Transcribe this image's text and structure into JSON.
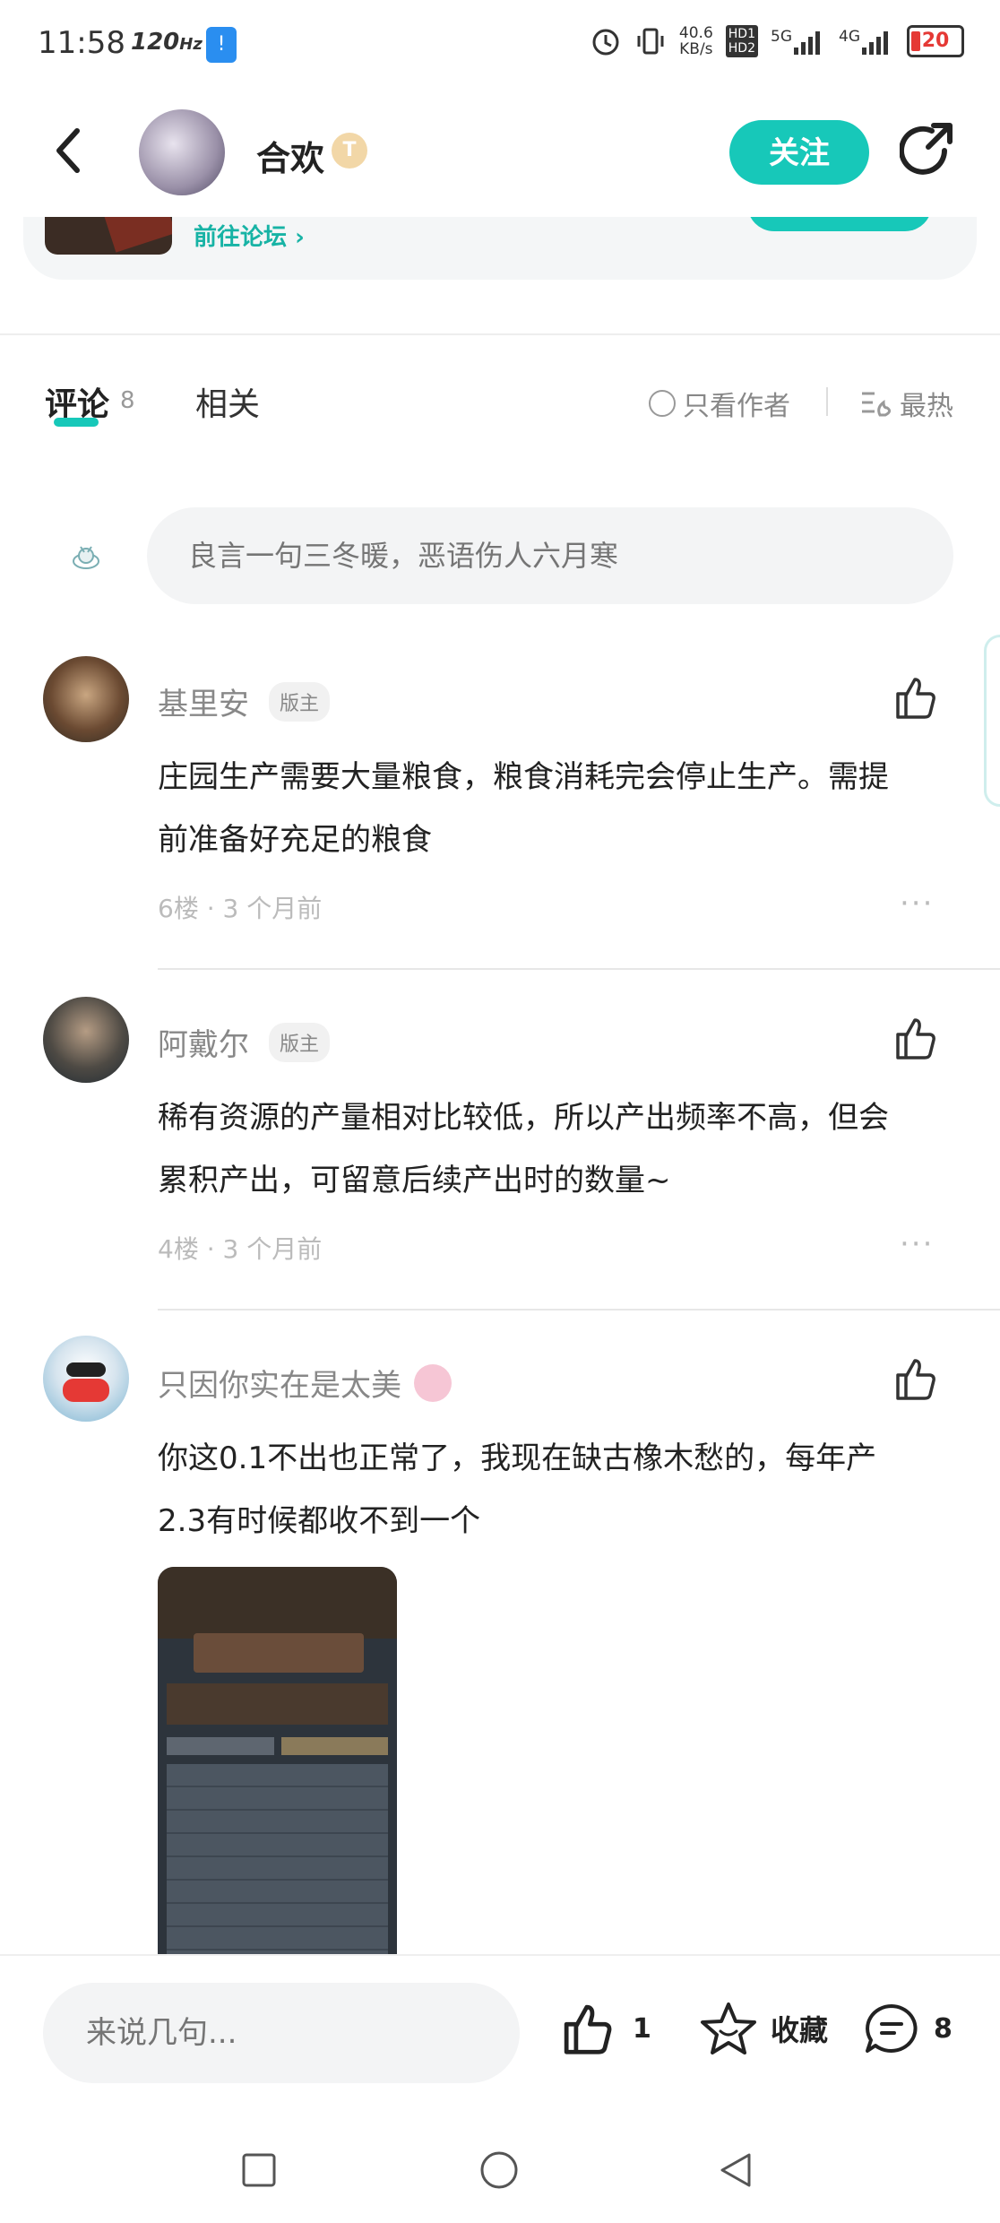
{
  "status_bar": {
    "time": "11:58",
    "refresh": "120",
    "refresh_unit": "Hz",
    "net_speed_top": "40.6",
    "net_speed_bottom": "KB/s",
    "hd1": "HD1",
    "hd2": "HD2",
    "sig5g": "5G",
    "sig4g": "4G",
    "battery": "20"
  },
  "header": {
    "author_name": "合欢",
    "level_badge": "T",
    "follow_label": "关注"
  },
  "forum_card": {
    "link_label": "前往论坛"
  },
  "tabs": {
    "comments_label": "评论",
    "comments_count": "8",
    "related_label": "相关",
    "only_author_label": "只看作者",
    "sort_label": "最热"
  },
  "comment_box": {
    "placeholder": "良言一句三冬暖，恶语伤人六月寒"
  },
  "comments": [
    {
      "name": "基里安",
      "badge": "版主",
      "line1": "庄园生产需要大量粮食，粮食消耗完会停止生产。需提",
      "line2": "前准备好充足的粮食",
      "meta": "6楼 · 3 个月前"
    },
    {
      "name": "阿戴尔",
      "badge": "版主",
      "line1": "稀有资源的产量相对比较低，所以产出频率不高，但会",
      "line2": "累积产出，可留意后续产出时的数量~",
      "meta": "4楼 · 3 个月前"
    },
    {
      "name": "只因你实在是太美",
      "line1": "你这0.1不出也正常了，我现在缺古橡木愁的，每年产",
      "line2": "2.3有时候都收不到一个"
    }
  ],
  "more_label": "···",
  "bottom_bar": {
    "input_placeholder": "来说几句...",
    "like_count": "1",
    "fav_label": "收藏",
    "comment_count": "8"
  }
}
